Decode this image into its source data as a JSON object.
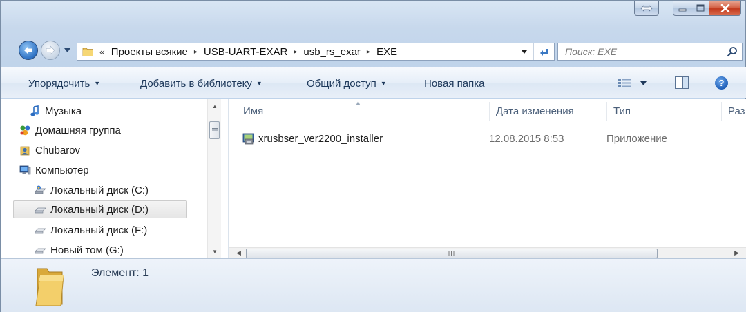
{
  "window": {
    "caption_buttons": [
      "restore-extra",
      "minimize",
      "maximize",
      "close"
    ]
  },
  "address": {
    "root_chevron": "«",
    "breadcrumbs": [
      "Проекты всякие",
      "USB-UART-EXAR",
      "usb_rs_exar",
      "EXE"
    ],
    "separator": "▸"
  },
  "search": {
    "placeholder": "Поиск: EXE"
  },
  "toolbar": {
    "organize": "Упорядочить",
    "add_to_library": "Добавить в библиотеку",
    "share": "Общий доступ",
    "new_folder": "Новая папка",
    "dropdown_arrow": "▼"
  },
  "nav_pane": {
    "items": [
      {
        "label": "Музыка",
        "icon": "music-icon"
      },
      {
        "label": "Домашняя группа",
        "icon": "homegroup-icon"
      },
      {
        "label": "Chubarov",
        "icon": "user-folder-icon"
      },
      {
        "label": "Компьютер",
        "icon": "computer-icon"
      },
      {
        "label": "Локальный диск (C:)",
        "icon": "system-drive-icon"
      },
      {
        "label": "Локальный диск (D:)",
        "icon": "drive-icon",
        "selected": true
      },
      {
        "label": "Локальный диск (F:)",
        "icon": "drive-icon"
      },
      {
        "label": "Новый том (G:)",
        "icon": "drive-icon"
      }
    ]
  },
  "file_list": {
    "columns": [
      "Имя",
      "Дата изменения",
      "Тип",
      "Раз"
    ],
    "files": [
      {
        "name": "xrusbser_ver2200_installer",
        "date": "12.08.2015 8:53",
        "type": "Приложение",
        "icon": "installer-icon"
      }
    ],
    "scroll_thumb": "III"
  },
  "details": {
    "text": "Элемент: 1"
  },
  "colors": {
    "window_frame": "#c7d8ec",
    "close_button": "#c2391c",
    "link_text": "#1e395b",
    "selection": "#e6e6e6"
  }
}
